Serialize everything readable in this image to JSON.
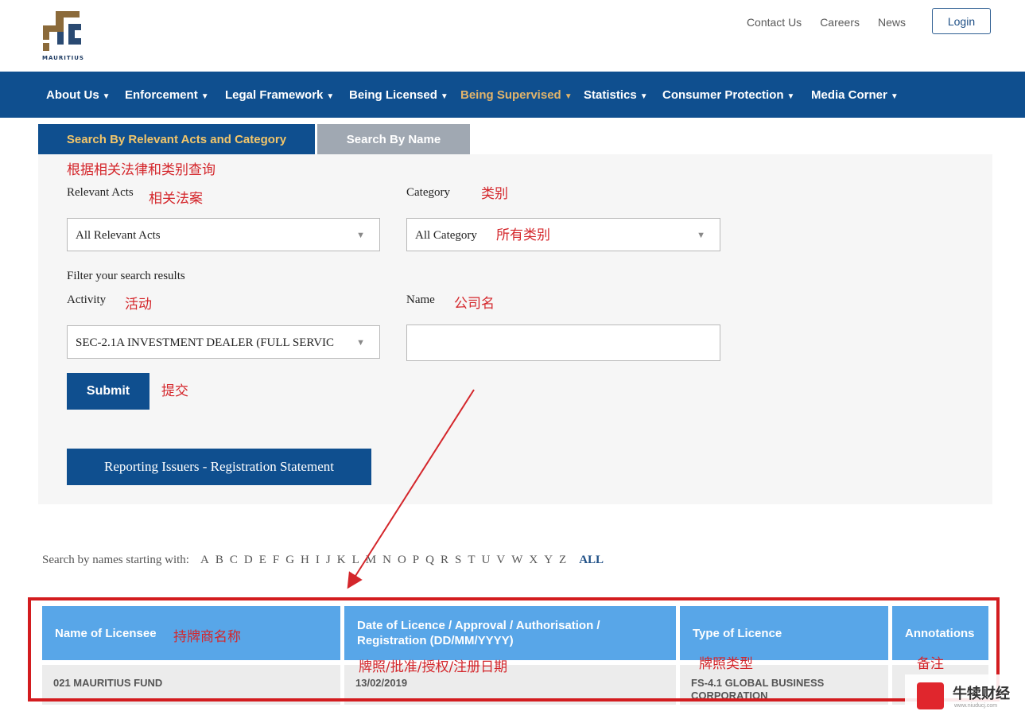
{
  "header": {
    "logo_text": "MAURITIUS",
    "links": [
      "Contact Us",
      "Careers",
      "News"
    ],
    "login_label": "Login"
  },
  "nav": {
    "items": [
      "About Us",
      "Enforcement",
      "Legal Framework",
      "Being Licensed",
      "Being Supervised",
      "Statistics",
      "Consumer Protection",
      "Media Corner"
    ],
    "active": "Being Supervised"
  },
  "tabs": {
    "tab1": "Search By Relevant Acts and Category",
    "tab2": "Search By Name"
  },
  "form": {
    "section_annotation": "根据相关法律和类别查询",
    "relevant_acts_label": "Relevant Acts",
    "relevant_acts_annotation": "相关法案",
    "relevant_acts_value": "All Relevant Acts",
    "category_label": "Category",
    "category_annotation": "类别",
    "category_value": "All Category",
    "category_value_annotation": "所有类别",
    "filter_label": "Filter your search results",
    "activity_label": "Activity",
    "activity_annotation": "活动",
    "activity_value": "SEC-2.1A INVESTMENT DEALER (FULL SERVIC",
    "name_label": "Name",
    "name_annotation": "公司名",
    "name_value": "",
    "submit_label": "Submit",
    "submit_annotation": "提交",
    "report_button": "Reporting Issuers - Registration Statement"
  },
  "alphabet": {
    "label": "Search by names starting with:",
    "letters": [
      "A",
      "B",
      "C",
      "D",
      "E",
      "F",
      "G",
      "H",
      "I",
      "J",
      "K",
      "L",
      "M",
      "N",
      "O",
      "P",
      "Q",
      "R",
      "S",
      "T",
      "U",
      "V",
      "W",
      "X",
      "Y",
      "Z"
    ],
    "all_label": "ALL"
  },
  "table": {
    "headers": [
      "Name of Licensee",
      "Date of Licence / Approval / Authorisation / Registration (DD/MM/YYYY)",
      "Type of Licence",
      "Annotations"
    ],
    "header_annotations": [
      "持牌商名称",
      "牌照/批准/授权/注册日期",
      "牌照类型",
      "备注"
    ],
    "rows": [
      [
        "021 MAURITIUS FUND",
        "13/02/2019",
        "FS-4.1 GLOBAL BUSINESS CORPORATION",
        ""
      ]
    ]
  },
  "watermark": {
    "brand": "牛犊财经",
    "url": "www.niuducj.com"
  },
  "colors": {
    "nav_bg": "#0f4f8f",
    "nav_active": "#e2b46a",
    "header_cell": "#58a6e8",
    "annotation": "#d4262b"
  }
}
